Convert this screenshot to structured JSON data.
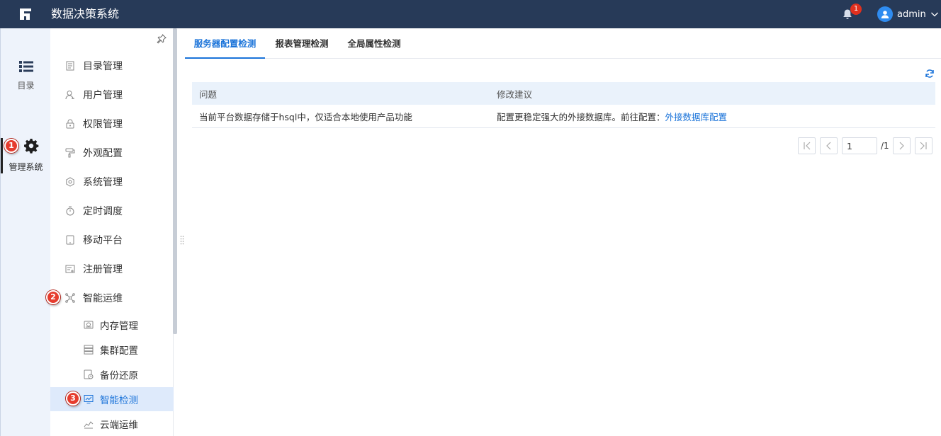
{
  "app": {
    "title": "数据决策系统"
  },
  "header": {
    "notification_count": "1",
    "username": "admin"
  },
  "rail": [
    {
      "label": "目录",
      "icon": "list-icon"
    },
    {
      "label": "管理系统",
      "icon": "gear-icon"
    }
  ],
  "menu": [
    {
      "label": "目录管理",
      "icon": "document-icon"
    },
    {
      "label": "用户管理",
      "icon": "user-icon"
    },
    {
      "label": "权限管理",
      "icon": "lock-icon"
    },
    {
      "label": "外观配置",
      "icon": "paint-roller-icon"
    },
    {
      "label": "系统管理",
      "icon": "settings-icon"
    },
    {
      "label": "定时调度",
      "icon": "stopwatch-icon"
    },
    {
      "label": "移动平台",
      "icon": "tablet-icon"
    },
    {
      "label": "注册管理",
      "icon": "register-icon"
    },
    {
      "label": "智能运维",
      "icon": "network-icon"
    }
  ],
  "submenu": [
    {
      "label": "内存管理",
      "icon": "memory-icon"
    },
    {
      "label": "集群配置",
      "icon": "server-stack-icon"
    },
    {
      "label": "备份还原",
      "icon": "backup-icon"
    },
    {
      "label": "智能检测",
      "icon": "monitor-icon",
      "active": true
    },
    {
      "label": "云端运维",
      "icon": "cloud-ops-icon"
    }
  ],
  "annotations": [
    "1",
    "2",
    "3"
  ],
  "tabs": [
    {
      "label": "服务器配置检测",
      "active": true
    },
    {
      "label": "报表管理检测"
    },
    {
      "label": "全局属性检测"
    }
  ],
  "table": {
    "headers": [
      "问题",
      "修改建议"
    ],
    "rows": [
      {
        "issue": "当前平台数据存储于hsql中，仅适合本地使用产品功能",
        "suggestion_prefix": "配置更稳定强大的外接数据库。前往配置：",
        "suggestion_link": "外接数据库配置"
      }
    ]
  },
  "pagination": {
    "current_page": "1",
    "total_label": "/1"
  },
  "colors": {
    "header_bg": "#273a58",
    "accent": "#1a73d9",
    "badge": "#e0301e",
    "active_row_bg": "#deeafb"
  }
}
